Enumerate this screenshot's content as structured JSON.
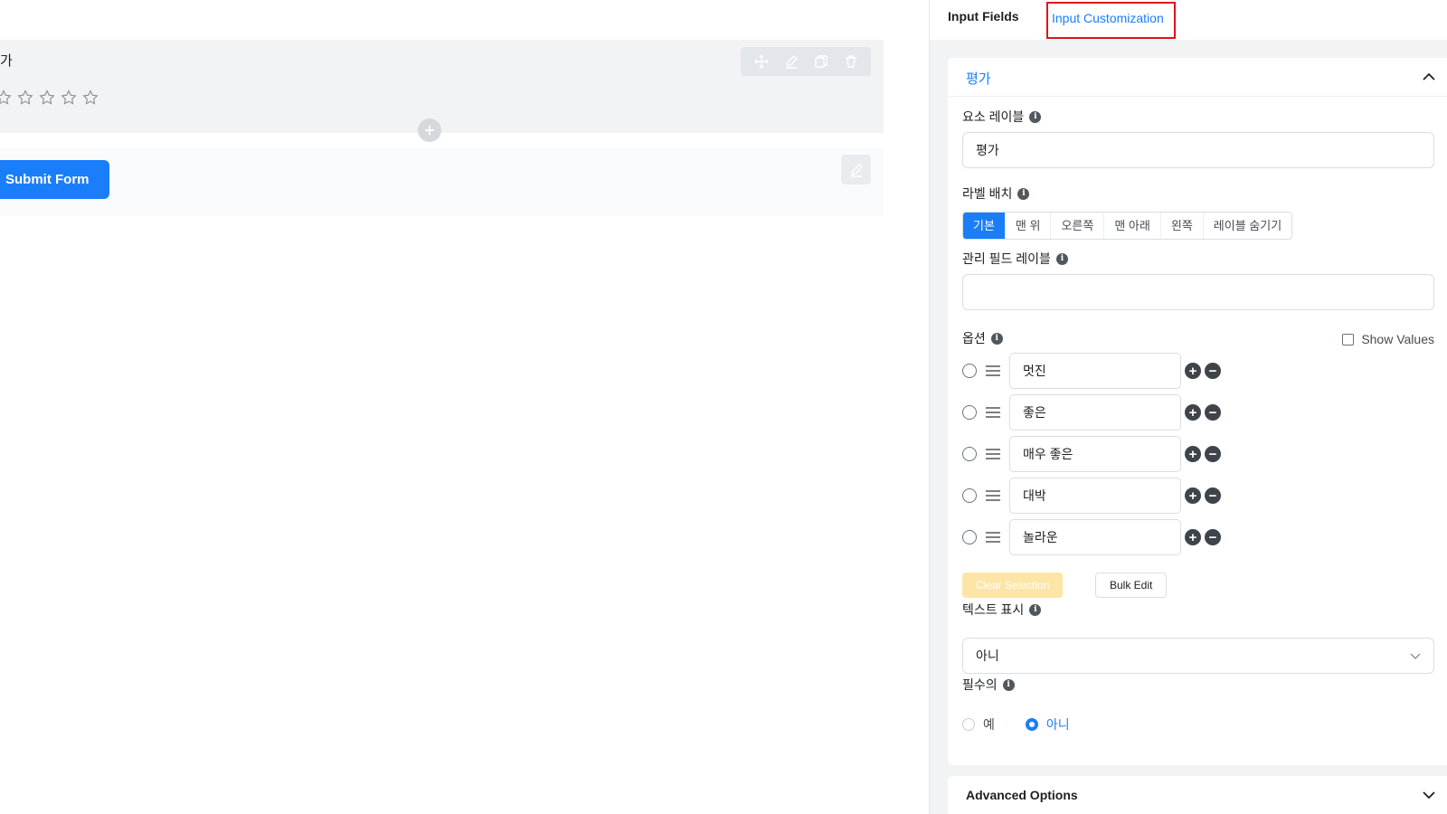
{
  "canvas": {
    "field_label": "가",
    "star_count": 5,
    "submit_label": "Submit Form"
  },
  "tabs": {
    "input_fields": "Input Fields",
    "input_customization": "Input Customization"
  },
  "panel": {
    "section_title": "평가",
    "element_label": {
      "label": "요소 레이블",
      "value": "평가"
    },
    "label_placement": {
      "label": "라벨 배치",
      "options": [
        "기본",
        "맨 위",
        "오른쪽",
        "맨 아래",
        "왼쪽",
        "레이블 숨기기"
      ],
      "selected": "기본"
    },
    "admin_field_label": {
      "label": "관리 필드 레이블",
      "value": ""
    },
    "options": {
      "label": "옵션",
      "show_values_label": "Show Values",
      "items": [
        "멋진",
        "좋은",
        "매우 좋은",
        "대박",
        "놀라운"
      ],
      "clear_selection": "Clear Selection",
      "bulk_edit": "Bulk Edit"
    },
    "show_text": {
      "label": "텍스트 표시",
      "value": "아니"
    },
    "required": {
      "label": "필수의",
      "yes": "예",
      "no": "아니",
      "selected": "아니"
    },
    "advanced_options": "Advanced Options"
  },
  "colors": {
    "accent": "#1a7efb",
    "highlight_border": "#e0111a",
    "clear_button": "#fde5a8"
  }
}
